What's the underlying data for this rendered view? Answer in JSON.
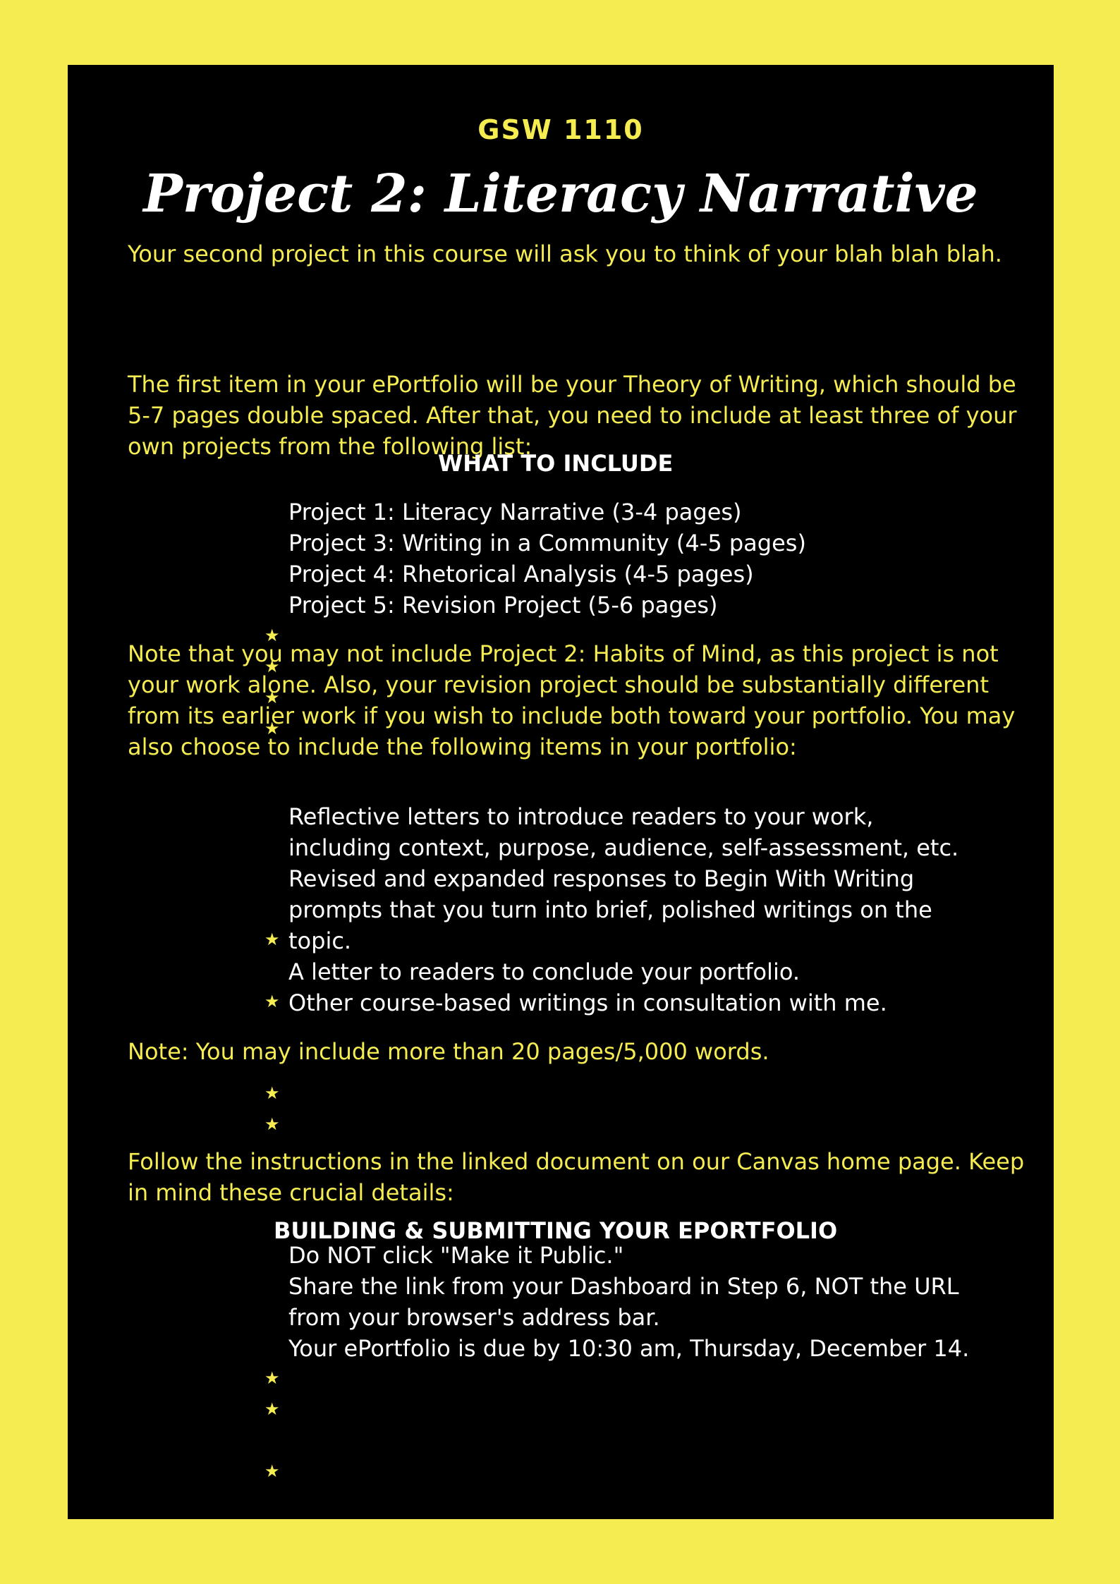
{
  "course_code": "GSW 1110",
  "title": "Project 2: Literacy Narrative",
  "intro": "Your second project in this course will ask you to think of your blah blah blah.",
  "paragraph_first_item": "The first item in your ePortfolio will be your Theory of Writing, which should be 5-7 pages double spaced. After that, you need to include at least three of your own projects from the following list:",
  "what_to_include_heading": "WHAT TO INCLUDE",
  "project_list": [
    "Project 1: Literacy Narrative (3-4 pages)",
    "Project 3: Writing in a Community (4-5 pages)",
    "Project 4: Rhetorical Analysis (4-5 pages)",
    "Project 5: Revision Project (5-6 pages)"
  ],
  "note_paragraph": "Note that you may not include Project 2: Habits of Mind, as this project is not your work alone. Also, your revision project should be substantially different from its earlier work if you wish to include both toward your portfolio. You may also choose to include the following items in your portfolio:",
  "optional_items_lines": [
    "Reflective letters to introduce readers to your work,",
    "including context, purpose, audience, self-assessment, etc.",
    "Revised and expanded responses to Begin With Writing",
    "prompts that you turn into brief, polished writings on the",
    "topic.",
    "A letter to readers to conclude your portfolio.",
    "Other course-based writings in consultation with me."
  ],
  "note_pages": "Note: You may include more than 20 pages/5,000 words.",
  "follow_instructions": "Follow the instructions in the linked document on our Canvas home page. Keep in mind these crucial details:",
  "building_heading": "BUILDING & SUBMITTING YOUR EPORTFOLIO",
  "details_lines": [
    "Do NOT click \"Make it Public.\"",
    "Share the link from your Dashboard in Step 6, NOT the URL",
    "from your browser's address bar.",
    "Your ePortfolio is due by 10:30 am, Thursday, December 14."
  ],
  "bullet_icon": "star-icon",
  "colors": {
    "accent": "#f5ec51",
    "panel": "#000000",
    "text": "#ffffff"
  }
}
